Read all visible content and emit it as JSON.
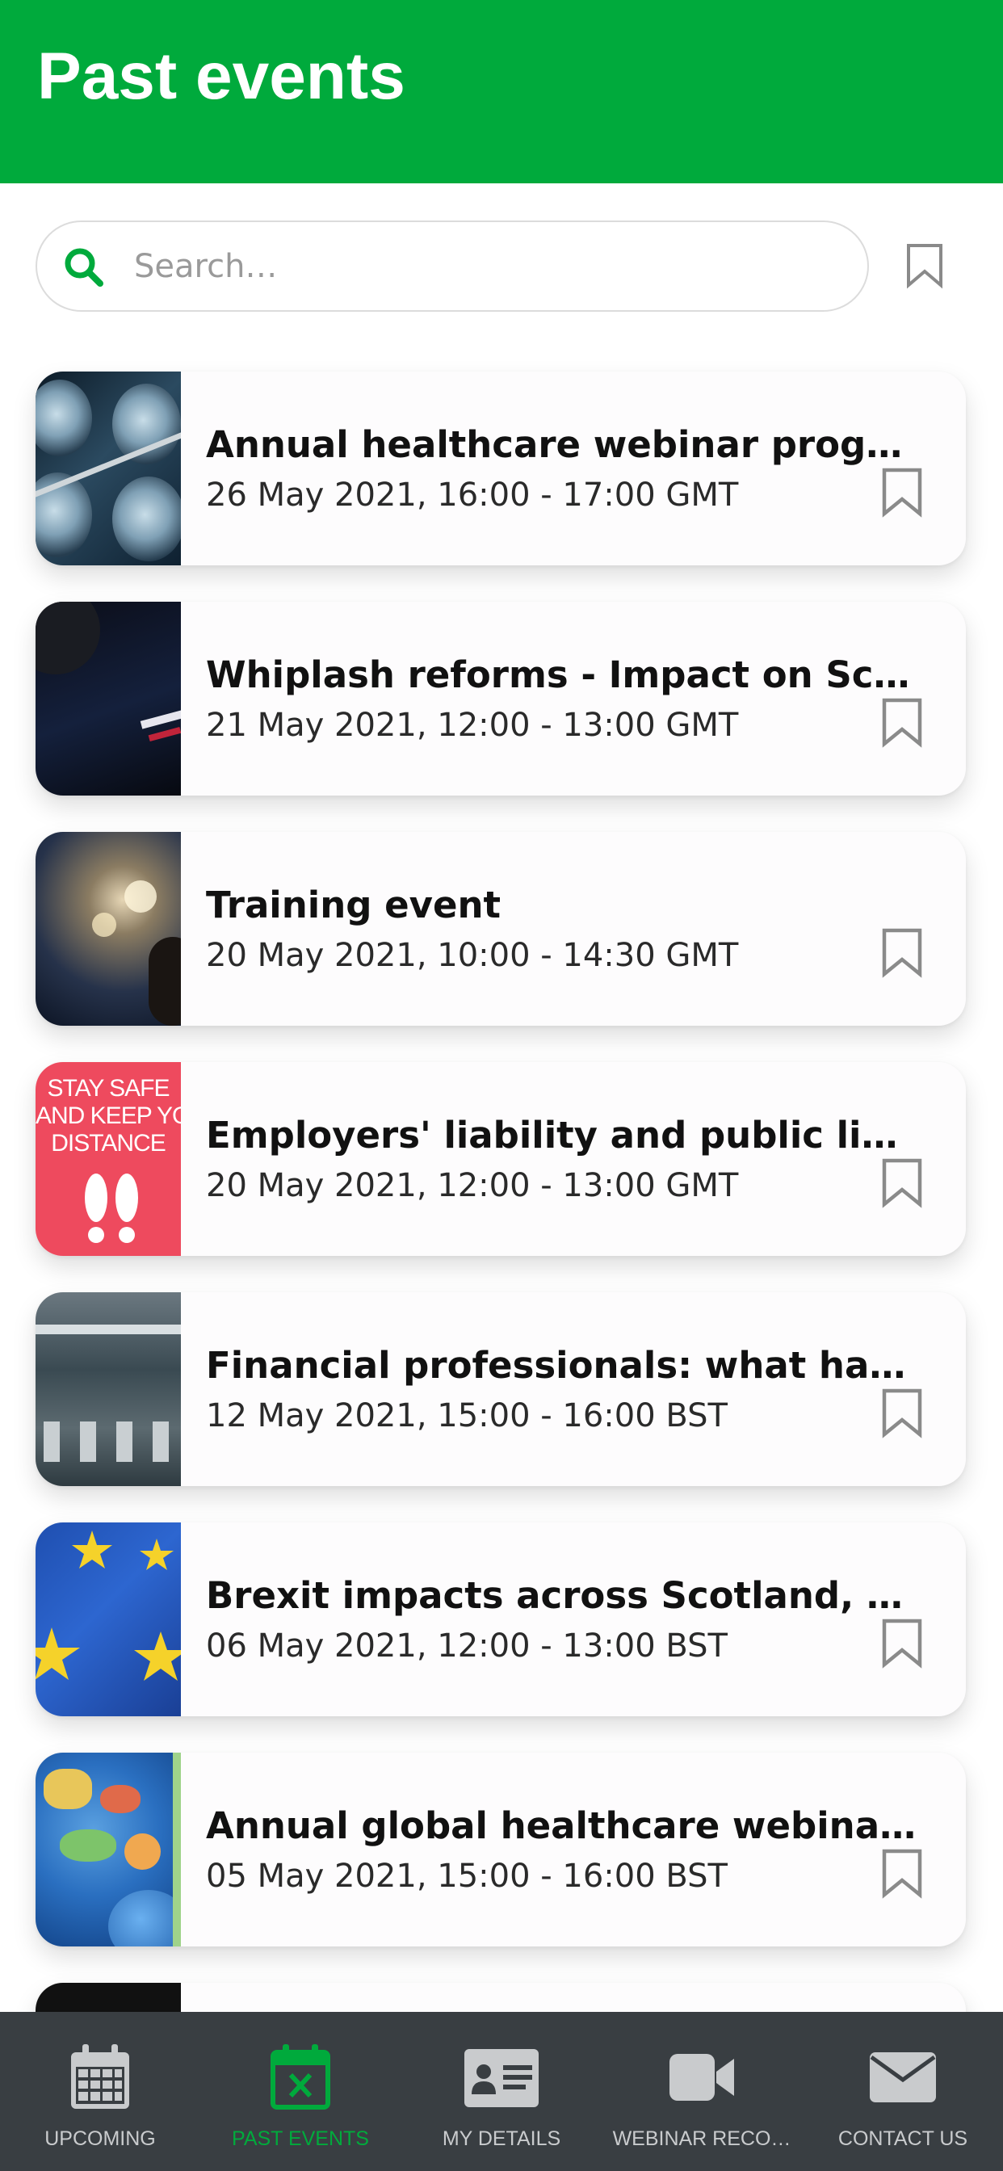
{
  "header": {
    "title": "Past events"
  },
  "search": {
    "placeholder": "Search…"
  },
  "events": [
    {
      "title": "Annual healthcare webinar progra…",
      "date": "26 May 2021, 16:00 - 17:00 GMT"
    },
    {
      "title": "Whiplash reforms - Impact on Scotl…",
      "date": "21 May 2021, 12:00 - 13:00 GMT"
    },
    {
      "title": "Training event",
      "date": "20 May 2021, 10:00 - 14:30 GMT"
    },
    {
      "title": "Employers' liability and public liabil…",
      "date": "20 May 2021, 12:00 - 13:00 GMT",
      "thumb_text": [
        "STAY SAFE",
        "AND KEEP YO",
        "DISTANCE"
      ]
    },
    {
      "title": "Financial professionals: what has b…",
      "date": "12 May 2021, 15:00 - 16:00 BST"
    },
    {
      "title": "Brexit impacts across Scotland, Nor…",
      "date": "06 May 2021, 12:00 - 13:00 BST"
    },
    {
      "title": "Annual global healthcare webinar p…",
      "date": "05 May 2021, 15:00 - 16:00 BST"
    }
  ],
  "nav": {
    "items": [
      {
        "label": "UPCOMING",
        "icon": "calendar-icon"
      },
      {
        "label": "PAST EVENTS",
        "icon": "calendar-x-icon",
        "active": true
      },
      {
        "label": "MY DETAILS",
        "icon": "id-card-icon"
      },
      {
        "label": "WEBINAR RECO…",
        "icon": "video-camera-icon"
      },
      {
        "label": "CONTACT US",
        "icon": "envelope-icon"
      }
    ]
  },
  "colors": {
    "brand_green": "#00aa3c",
    "nav_background": "#393e42",
    "nav_inactive": "#c9cbcd",
    "bookmark_gray": "#8a8a8a"
  }
}
